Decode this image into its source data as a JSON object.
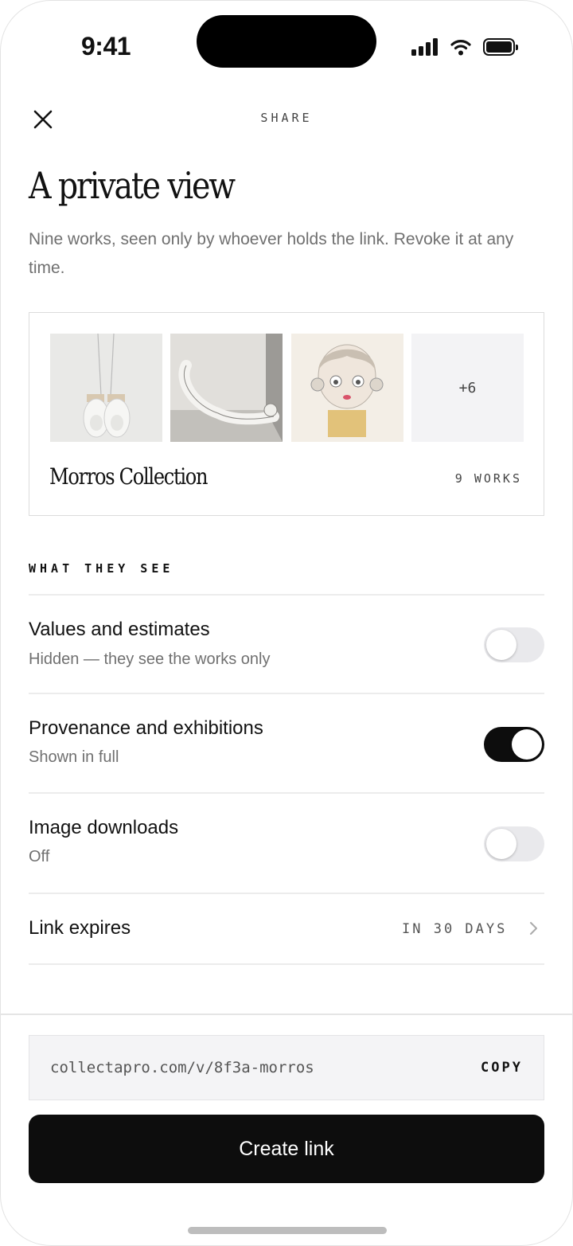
{
  "status_bar": {
    "time": "9:41",
    "signal_icon": "signal-bars-icon",
    "wifi_icon": "wifi-icon",
    "battery_icon": "battery-icon"
  },
  "header": {
    "close_icon": "close-icon",
    "label": "SHARE"
  },
  "intro": {
    "title": "A private view",
    "subtitle": "Nine works, seen only by whoever holds the link. Revoke it at any time."
  },
  "collection": {
    "name": "Morros Collection",
    "count": "9 WORKS",
    "thumbnails": [
      "boxing-gloves-artwork",
      "reclining-figure-drawing",
      "child-portrait-painting"
    ],
    "more_label": "+6"
  },
  "permissions": {
    "section_label": "WHAT THEY SEE",
    "items": [
      {
        "title": "Values and estimates",
        "subtitle": "Hidden — they see the works only",
        "enabled": false
      },
      {
        "title": "Provenance and exhibitions",
        "subtitle": "Shown in full",
        "enabled": true
      },
      {
        "title": "Image downloads",
        "subtitle": "Off",
        "enabled": false
      }
    ],
    "expires": {
      "title": "Link expires",
      "value": "IN 30 DAYS",
      "icon": "chevron-right-icon"
    }
  },
  "footer": {
    "link_url": "collectapro.com/v/8f3a-morros",
    "copy_label": "COPY",
    "create_label": "Create link"
  },
  "colors": {
    "accent": "#0d0d0d",
    "muted": "#707070",
    "toggle_off": "#e9e9ec"
  }
}
